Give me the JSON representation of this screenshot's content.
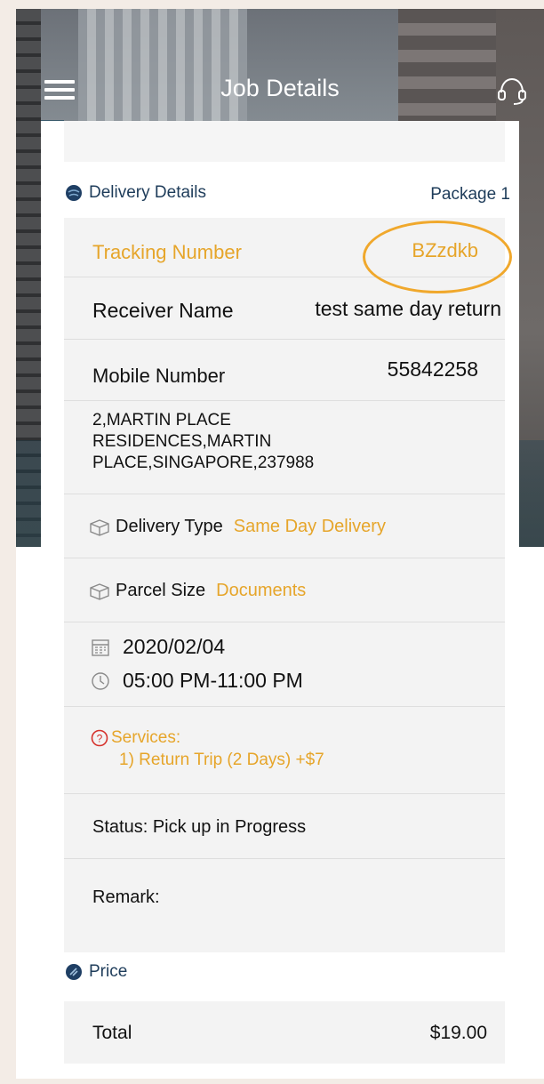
{
  "header": {
    "title": "Job Details",
    "menu_icon": "hamburger-icon",
    "support_icon": "headset-icon"
  },
  "delivery": {
    "section_label": "Delivery Details",
    "package_label": "Package 1",
    "tracking_label": "Tracking Number",
    "tracking_value": "BZzdkb",
    "receiver_label": "Receiver Name",
    "receiver_value": "test same day return",
    "mobile_label": "Mobile Number",
    "mobile_value": "55842258",
    "address_line1": "2,MARTIN PLACE",
    "address_line2": "RESIDENCES,MARTIN",
    "address_line3": "PLACE,SINGAPORE,237988",
    "delivery_type_label": "Delivery Type",
    "delivery_type_value": "Same Day Delivery",
    "parcel_size_label": "Parcel Size",
    "parcel_size_value": "Documents",
    "date": "2020/02/04",
    "time": "05:00 PM-11:00 PM",
    "services_label": "Services:",
    "services_item": "1) Return Trip (2 Days) +$7",
    "status": "Status:  Pick up in Progress",
    "remark": "Remark:"
  },
  "price": {
    "section_label": "Price",
    "total_label": "Total",
    "total_value": "$19.00"
  },
  "colors": {
    "accent": "#e6a52a",
    "navy": "#1e3c5a",
    "error": "#d6322c"
  }
}
